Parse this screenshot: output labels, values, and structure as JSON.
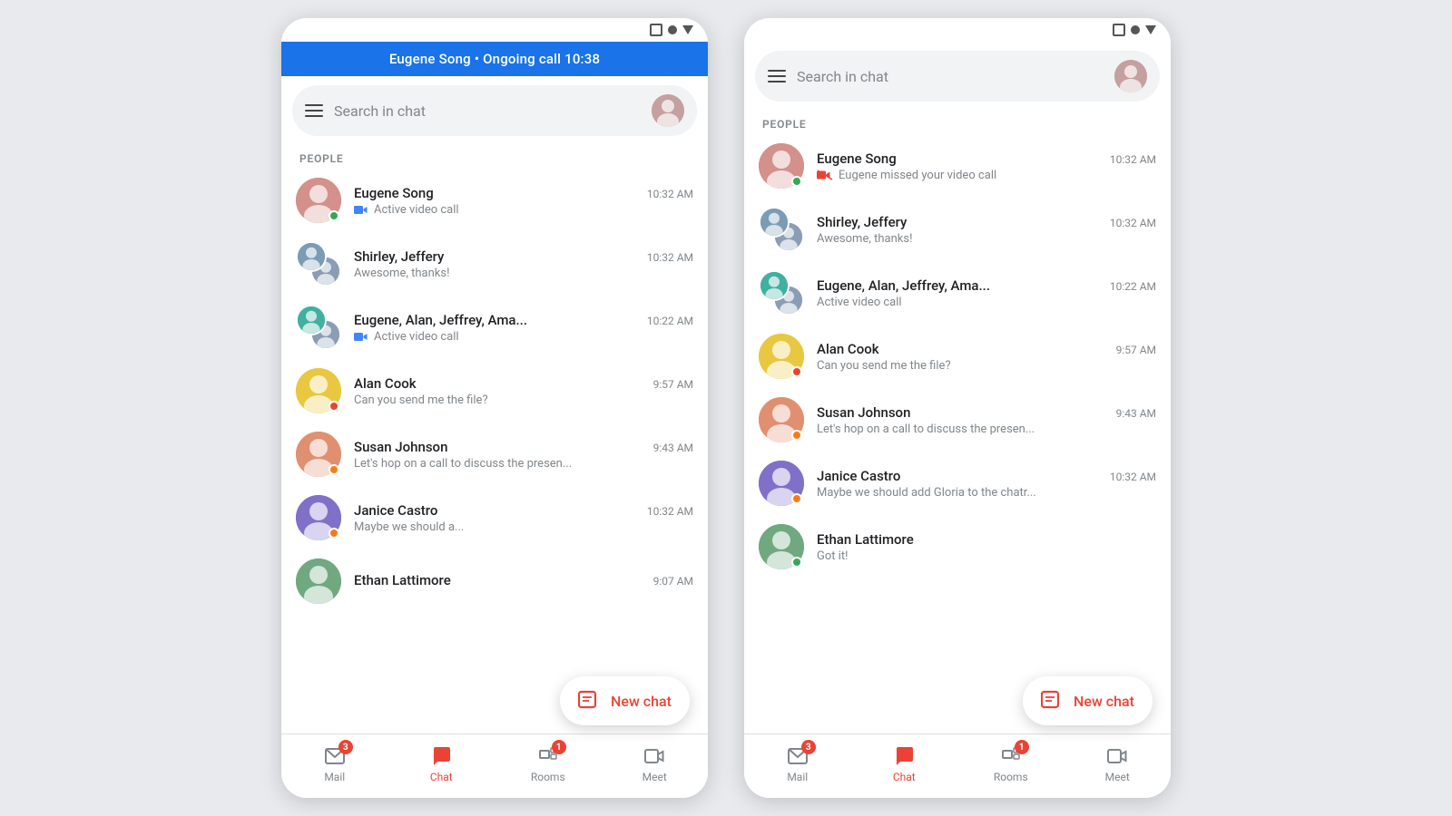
{
  "phones": [
    {
      "id": "phone-left",
      "active_call_banner": "Eugene Song • Ongoing call 10:38",
      "search_placeholder": "Search in chat",
      "section_label": "PEOPLE",
      "chats": [
        {
          "name": "Eugene Song",
          "time": "10:32 AM",
          "preview": "Active video call",
          "preview_icon": "video",
          "avatar_type": "single",
          "avatar_color": "bg-pink",
          "status_dot": "green"
        },
        {
          "name": "Shirley, Jeffery",
          "time": "10:32 AM",
          "preview": "Awesome, thanks!",
          "preview_icon": null,
          "avatar_type": "group",
          "avatar_color": "bg-blue-gray",
          "status_dot": null
        },
        {
          "name": "Eugene, Alan, Jeffrey, Ama...",
          "time": "10:22 AM",
          "preview": "Active video call",
          "preview_icon": "video",
          "avatar_type": "group",
          "avatar_color": "bg-teal",
          "status_dot": null
        },
        {
          "name": "Alan Cook",
          "time": "9:57 AM",
          "preview": "Can you send me the file?",
          "preview_icon": null,
          "avatar_type": "single",
          "avatar_color": "bg-yellow",
          "status_dot": "red"
        },
        {
          "name": "Susan Johnson",
          "time": "9:43 AM",
          "preview": "Let's hop on a call to discuss the presen...",
          "preview_icon": null,
          "avatar_type": "single",
          "avatar_color": "bg-peach",
          "status_dot": "orange"
        },
        {
          "name": "Janice Castro",
          "time": "10:32 AM",
          "preview": "Maybe we should a...",
          "preview_icon": null,
          "avatar_type": "single",
          "avatar_color": "bg-purple",
          "status_dot": "orange"
        },
        {
          "name": "Ethan Lattimore",
          "time": "9:07 AM",
          "preview": "",
          "preview_icon": null,
          "avatar_type": "single",
          "avatar_color": "bg-green-gray",
          "status_dot": null
        }
      ],
      "fab": "New chat",
      "nav": [
        {
          "label": "Mail",
          "icon": "mail",
          "badge": 3,
          "active": false
        },
        {
          "label": "Chat",
          "icon": "chat",
          "badge": 0,
          "active": true
        },
        {
          "label": "Rooms",
          "icon": "rooms",
          "badge": 1,
          "active": false
        },
        {
          "label": "Meet",
          "icon": "meet",
          "badge": 0,
          "active": false
        }
      ]
    },
    {
      "id": "phone-right",
      "active_call_banner": null,
      "search_placeholder": "Search in chat",
      "section_label": "PEOPLE",
      "chats": [
        {
          "name": "Eugene Song",
          "time": "10:32 AM",
          "preview": "Eugene missed your video call",
          "preview_icon": "missed-video",
          "avatar_type": "single",
          "avatar_color": "bg-pink",
          "status_dot": "green"
        },
        {
          "name": "Shirley, Jeffery",
          "time": "10:32 AM",
          "preview": "Awesome, thanks!",
          "preview_icon": null,
          "avatar_type": "group",
          "avatar_color": "bg-blue-gray",
          "status_dot": null
        },
        {
          "name": "Eugene, Alan, Jeffrey, Ama...",
          "time": "10:22 AM",
          "preview": "Active video call",
          "preview_icon": null,
          "avatar_type": "group",
          "avatar_color": "bg-teal",
          "status_dot": null
        },
        {
          "name": "Alan Cook",
          "time": "9:57 AM",
          "preview": "Can you send me the file?",
          "preview_icon": null,
          "avatar_type": "single",
          "avatar_color": "bg-yellow",
          "status_dot": "red"
        },
        {
          "name": "Susan Johnson",
          "time": "9:43 AM",
          "preview": "Let's hop on a call to discuss the presen...",
          "preview_icon": null,
          "avatar_type": "single",
          "avatar_color": "bg-peach",
          "status_dot": "orange"
        },
        {
          "name": "Janice Castro",
          "time": "10:32 AM",
          "preview": "Maybe we should add Gloria to the chatr...",
          "preview_icon": null,
          "avatar_type": "single",
          "avatar_color": "bg-purple",
          "status_dot": "orange"
        },
        {
          "name": "Ethan Lattimore",
          "time": "",
          "preview": "Got it!",
          "preview_icon": null,
          "avatar_type": "single",
          "avatar_color": "bg-green-gray",
          "status_dot": "green"
        }
      ],
      "fab": "New chat",
      "nav": [
        {
          "label": "Mail",
          "icon": "mail",
          "badge": 3,
          "active": false
        },
        {
          "label": "Chat",
          "icon": "chat",
          "badge": 0,
          "active": true
        },
        {
          "label": "Rooms",
          "icon": "rooms",
          "badge": 1,
          "active": false
        },
        {
          "label": "Meet",
          "icon": "meet",
          "badge": 0,
          "active": false
        }
      ]
    }
  ]
}
